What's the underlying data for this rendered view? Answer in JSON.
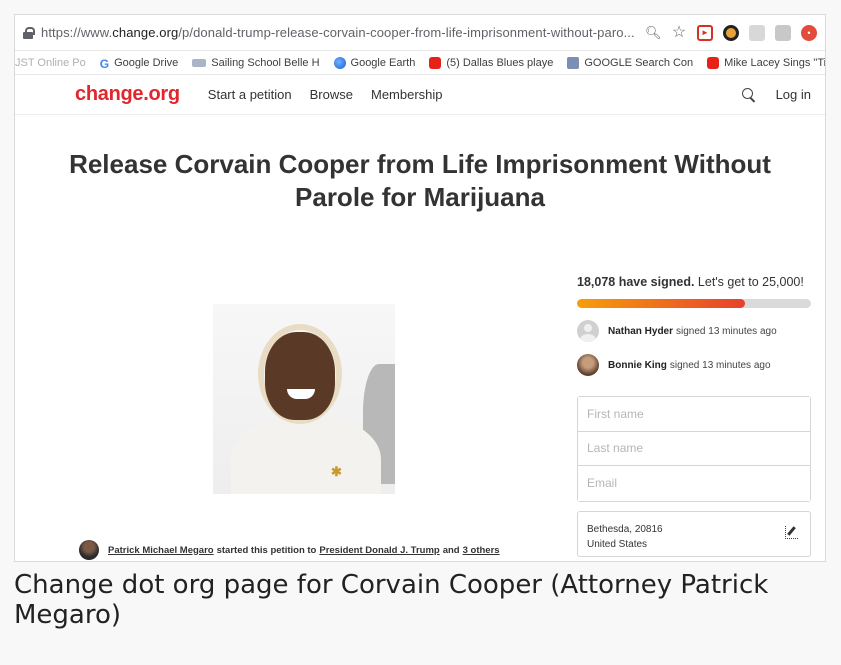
{
  "browser": {
    "url_prefix": "https://www.",
    "url_domain": "change.org",
    "url_path": "/p/donald-trump-release-corvain-cooper-from-life-imprisonment-without-paro..."
  },
  "bookmarks": [
    {
      "label": "JST Online Po",
      "icon": "bookmark-icon"
    },
    {
      "label": "Google Drive",
      "icon": "google-icon"
    },
    {
      "label": "Sailing School Belle H",
      "icon": "sailing-icon"
    },
    {
      "label": "Google Earth",
      "icon": "earth-icon"
    },
    {
      "label": "(5) Dallas Blues playe",
      "icon": "youtube-icon"
    },
    {
      "label": "GOOGLE Search Con",
      "icon": "bank-icon"
    },
    {
      "label": "Mike Lacey Sings \"Ti",
      "icon": "youtube-icon"
    }
  ],
  "nav": {
    "logo": "change.org",
    "start_petition": "Start a petition",
    "browse": "Browse",
    "membership": "Membership",
    "login": "Log in"
  },
  "petition": {
    "title": "Release Corvain Cooper from Life Imprisonment Without Parole for Marijuana",
    "signed_count": "18,078 have signed.",
    "goal_text": "Let's get to 25,000!",
    "progress_fraction": 0.72,
    "recent_signers": [
      {
        "name": "Nathan Hyder",
        "text": "signed 13 minutes ago"
      },
      {
        "name": "Bonnie King",
        "text": "signed 13 minutes ago"
      }
    ],
    "form": {
      "first_name_placeholder": "First name",
      "last_name_placeholder": "Last name",
      "email_placeholder": "Email"
    },
    "location_line1": "Bethesda, 20816",
    "location_line2": "United States",
    "starter_name": "Patrick Michael Megaro",
    "starter_text": "started this petition to",
    "recipient": "President Donald J. Trump",
    "and_text": "and",
    "others": "3 others"
  },
  "caption": "Change dot org page for Corvain Cooper (Attorney Patrick Megaro)"
}
